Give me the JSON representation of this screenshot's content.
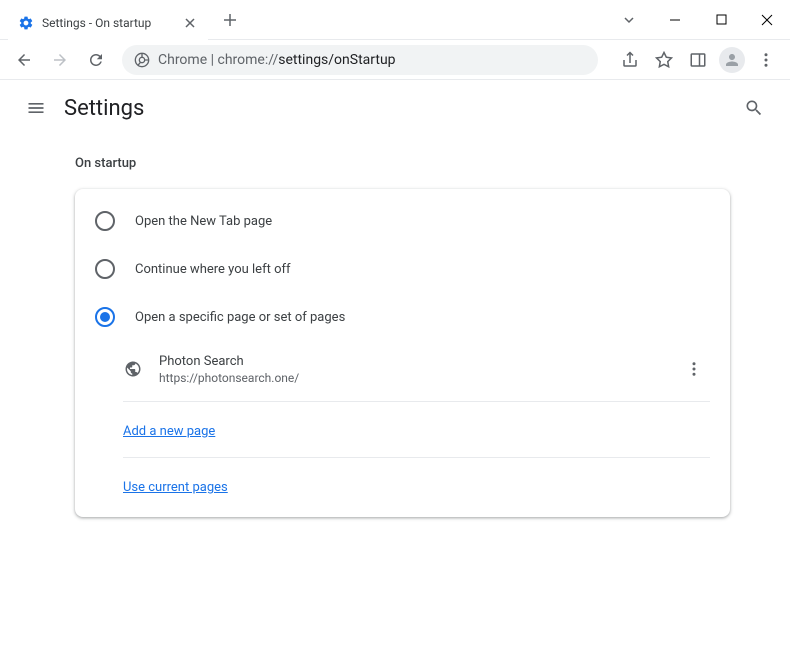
{
  "window": {
    "tab_title": "Settings - On startup"
  },
  "omnibox": {
    "prefix": "Chrome",
    "separator": " | ",
    "host": "chrome://",
    "path": "settings/onStartup"
  },
  "header": {
    "title": "Settings"
  },
  "section": {
    "title": "On startup"
  },
  "options": {
    "opt1": "Open the New Tab page",
    "opt2": "Continue where you left off",
    "opt3": "Open a specific page or set of pages"
  },
  "page": {
    "name": "Photon Search",
    "url": "https://photonsearch.one/"
  },
  "links": {
    "add": "Add a new page",
    "use_current": "Use current pages"
  }
}
